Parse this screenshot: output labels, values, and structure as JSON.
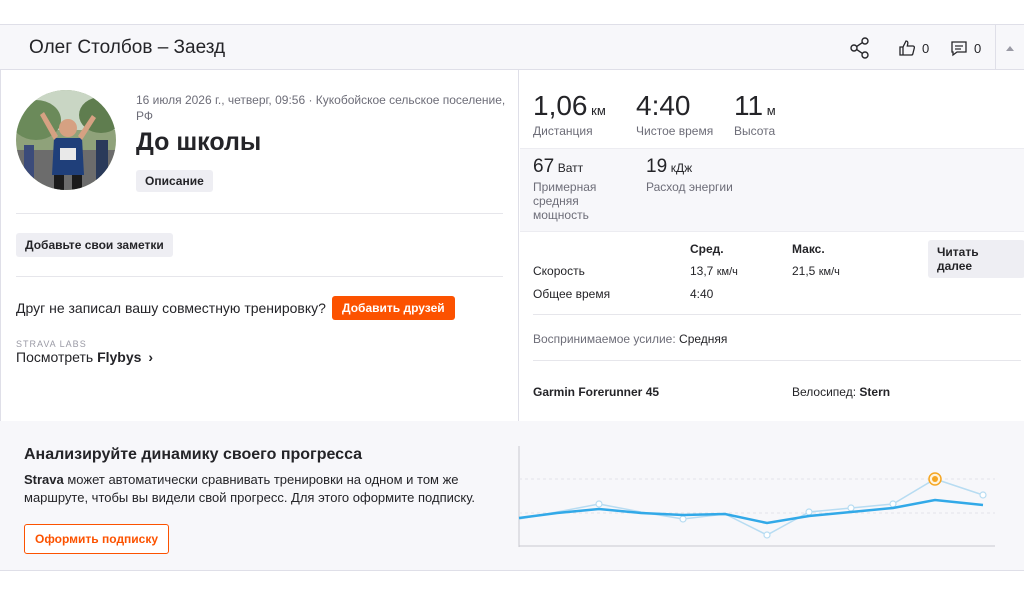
{
  "header": {
    "title": "Олег Столбов – Заезд",
    "kudos_count": "0",
    "comments_count": "0"
  },
  "activity": {
    "meta": "16 июля 2026 г., четверг, 09:56 · Кукобойское сельское поселение, РФ",
    "title": "До школы",
    "description_button": "Описание",
    "notes_button": "Добавьте свои заметки",
    "friend_prompt": "Друг не записал вашу совместную тренировку?",
    "add_friends_button": "Добавить друзей",
    "labs_label": "STRAVA LABS",
    "flybys_prefix": "Посмотреть",
    "flybys_link": "Flybys",
    "flybys_chevron": "›"
  },
  "stats": {
    "primary": [
      {
        "value": "1,06",
        "unit": "км",
        "label": "Дистанция"
      },
      {
        "value": "4:40",
        "unit": "",
        "label": "Чистое время"
      },
      {
        "value": "11",
        "unit": "м",
        "label": "Высота"
      }
    ],
    "secondary": [
      {
        "value": "67",
        "unit": "Ватт",
        "label": "Примерная средняя мощность"
      },
      {
        "value": "19",
        "unit": "кДж",
        "label": "Расход энергии"
      }
    ],
    "table": {
      "col_avg": "Сред.",
      "col_max": "Макс.",
      "rows": [
        {
          "label": "Скорость",
          "avg": "13,7",
          "avg_unit": "км/ч",
          "max": "21,5",
          "max_unit": "км/ч"
        },
        {
          "label": "Общее время",
          "avg": "4:40",
          "avg_unit": "",
          "max": "",
          "max_unit": ""
        }
      ]
    },
    "read_more_button": "Читать далее",
    "effort_label": "Воспринимаемое усилие:",
    "effort_value": "Средняя",
    "device": "Garmin Forerunner 45",
    "bike_label": "Велосипед:",
    "bike_value": "Stern"
  },
  "promo": {
    "heading": "Анализируйте динамику своего прогресса",
    "brand": "Strava",
    "text": " может автоматически сравнивать тренировки на одном и том же маршруте, чтобы вы видели свой прогресс. Для этого оформите подписку.",
    "subscribe_button": "Оформить подписку"
  },
  "colors": {
    "accent": "#fc5200",
    "chart_line": "#32a9e8",
    "chart_line_light": "#b7dcf2",
    "highlight_dot": "#f5a623"
  }
}
